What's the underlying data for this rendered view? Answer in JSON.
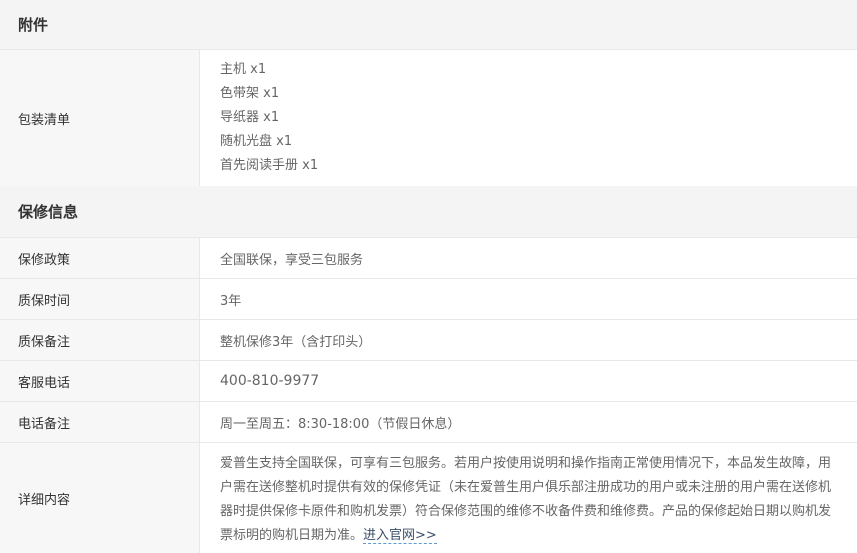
{
  "accessories": {
    "title": "附件",
    "packing": {
      "label": "包装清单",
      "items": [
        "主机 x1",
        "色带架 x1",
        "导纸器 x1",
        "随机光盘 x1",
        "首先阅读手册 x1"
      ]
    }
  },
  "warranty": {
    "title": "保修信息",
    "rows": [
      {
        "label": "保修政策",
        "value": "全国联保，享受三包服务"
      },
      {
        "label": "质保时间",
        "value": "3年"
      },
      {
        "label": "质保备注",
        "value": "整机保修3年（含打印头）"
      },
      {
        "label": "客服电话",
        "value": "400-810-9977"
      },
      {
        "label": "电话备注",
        "value": "周一至周五：8:30-18:00（节假日休息）"
      }
    ],
    "detail": {
      "label": "详细内容",
      "text": "爱普生支持全国联保，可享有三包服务。若用户按使用说明和操作指南正常使用情况下，本品发生故障，用户需在送修整机时提供有效的保修凭证（未在爱普生用户俱乐部注册成功的用户或未注册的用户需在送修机器时提供保修卡原件和购机发票）符合保修范围的维修不收备件费和维修费。产品的保修起始日期以购机发票标明的购机日期为准。",
      "link": "进入官网>>"
    }
  }
}
